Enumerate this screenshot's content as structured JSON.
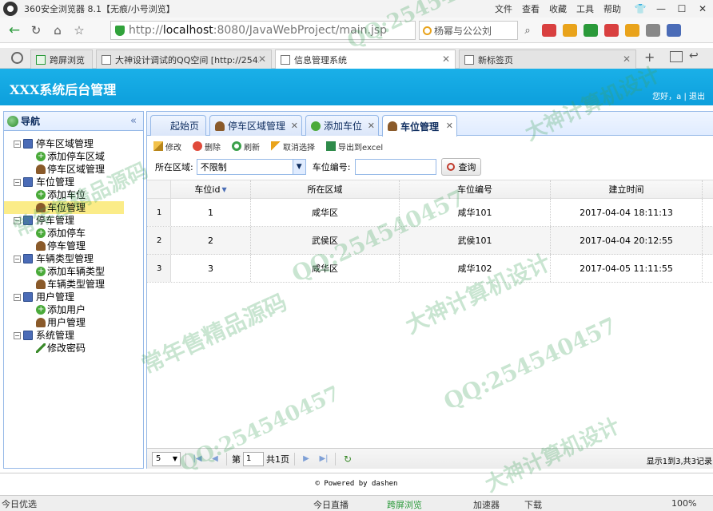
{
  "browser": {
    "window_title": "360安全浏览器 8.1【无痕/小号浏览】",
    "menus": [
      "文件",
      "查看",
      "收藏",
      "工具",
      "帮助"
    ],
    "url_scheme": "http://",
    "url_host": "localhost",
    "url_rest": ":8080/JavaWebProject/main.jsp",
    "search_text": "杨幂与公公刘",
    "tabs": [
      {
        "label": "跨屏浏览"
      },
      {
        "label": "大神设计调试的QQ空间 [http://2545"
      },
      {
        "label": "信息管理系统"
      },
      {
        "label": "新标签页"
      }
    ]
  },
  "app": {
    "title": "XXX系统后台管理",
    "greeting": "您好，a",
    "separator": "|",
    "logout": "退出"
  },
  "sidebar": {
    "title": "导航",
    "collapse": "«",
    "tree": [
      {
        "label": "停车区域管理",
        "level": 0
      },
      {
        "label": "添加停车区域",
        "level": 1
      },
      {
        "label": "停车区域管理",
        "level": 1
      },
      {
        "label": "车位管理",
        "level": 0
      },
      {
        "label": "添加车位",
        "level": 1
      },
      {
        "label": "车位管理",
        "level": 1
      },
      {
        "label": "停车管理",
        "level": 0
      },
      {
        "label": "添加停车",
        "level": 1
      },
      {
        "label": "停车管理",
        "level": 1
      },
      {
        "label": "车辆类型管理",
        "level": 0
      },
      {
        "label": "添加车辆类型",
        "level": 1
      },
      {
        "label": "车辆类型管理",
        "level": 1
      },
      {
        "label": "用户管理",
        "level": 0
      },
      {
        "label": "添加用户",
        "level": 1
      },
      {
        "label": "用户管理",
        "level": 1
      },
      {
        "label": "系统管理",
        "level": 0
      },
      {
        "label": "修改密码",
        "level": 1
      }
    ]
  },
  "app_tabs": [
    "起始页",
    "停车区域管理",
    "添加车位",
    "车位管理"
  ],
  "toolbar": {
    "edit": "修改",
    "delete": "删除",
    "refresh": "刷新",
    "unselect": "取消选择",
    "export": "导出到excel"
  },
  "search": {
    "area_label": "所在区域:",
    "area_value": "不限制",
    "code_label": "车位编号:",
    "code_value": "",
    "query": "查询"
  },
  "grid": {
    "columns": [
      "车位id",
      "所在区域",
      "车位编号",
      "建立时间"
    ],
    "rows": [
      {
        "rn": "1",
        "id": "1",
        "area": "咸华区",
        "code": "咸华101",
        "time": "2017-04-04 18:11:13"
      },
      {
        "rn": "2",
        "id": "2",
        "area": "武侯区",
        "code": "武侯101",
        "time": "2017-04-04 20:12:55"
      },
      {
        "rn": "3",
        "id": "3",
        "area": "咸华区",
        "code": "咸华102",
        "time": "2017-04-05 11:11:55"
      }
    ]
  },
  "pager": {
    "page_size": "5",
    "page_prefix": "第",
    "page_value": "1",
    "page_total": "共1页",
    "info": "显示1到3,共3记录"
  },
  "footer": {
    "text": "© Powered by dashen"
  },
  "statusbar": {
    "left": "今日优选",
    "live": "今日直播",
    "cross": "跨屏浏览",
    "accel": "加速器",
    "download": "下载",
    "zoom": "100%"
  },
  "watermarks": [
    "QQ:254540457",
    "大神计算机设计",
    "常年售精品源码",
    "QQ:254540457",
    "大神计算机设计",
    "常年售精品源码",
    "QQ:254540457",
    "QQ:254540457",
    "大神计算机设计"
  ]
}
